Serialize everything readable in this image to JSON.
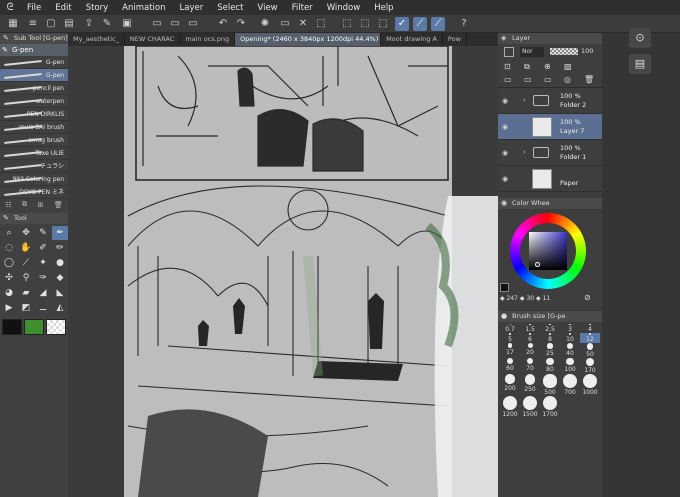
{
  "app": {
    "logo": "ᘓ"
  },
  "menu": [
    "File",
    "Edit",
    "Story",
    "Animation",
    "Layer",
    "Select",
    "View",
    "Filter",
    "Window",
    "Help"
  ],
  "tabs": [
    {
      "label": "My_aesthetic_",
      "active": false
    },
    {
      "label": "NEW CHARAC",
      "active": false
    },
    {
      "label": "main ocs.png",
      "active": false
    },
    {
      "label": "Opening* (2460 x 3840px 1200dpi 44.4%)",
      "active": true
    },
    {
      "label": "Moot drawing A",
      "active": false
    },
    {
      "label": "Pow",
      "active": false
    }
  ],
  "subtool": {
    "header": "Sub Tool [G-pen]",
    "current": "G-pen",
    "brushes": [
      {
        "label": "G-pen",
        "selected": false
      },
      {
        "label": "G-pen",
        "selected": true
      },
      {
        "label": "pencil pen",
        "selected": false
      },
      {
        "label": "waterpen",
        "selected": false
      },
      {
        "label": "PEN DIRKLIS",
        "selected": false
      },
      {
        "label": "muis SAI brush",
        "selected": false
      },
      {
        "label": "smog brush",
        "selected": false
      },
      {
        "label": "Taxe ULIE",
        "selected": false
      },
      {
        "label": "チュラシ",
        "selected": false
      },
      {
        "label": "993 Coloring pen",
        "selected": false
      },
      {
        "label": "DOYO PEN ミネ",
        "selected": false
      }
    ]
  },
  "tool_panel": {
    "header": "Tool",
    "icons": [
      "search-icon",
      "move-icon",
      "pen-icon",
      "pen-alt-icon",
      "lasso-icon",
      "hand-icon",
      "brush-icon",
      "pencil-icon",
      "oval-select-icon",
      "eyedropper-icon",
      "sparkle-icon",
      "drop-icon",
      "move-layer-icon",
      "pin-icon",
      "pen-nib-icon",
      "eraser-icon",
      "fill-icon",
      "gradient-icon",
      "ruler-icon",
      "shape-icon",
      "text-icon",
      "balloon-icon",
      "line-icon",
      "vector-icon"
    ]
  },
  "colors": {
    "main": "#111111",
    "sub": "#3f8f2f",
    "accent": "#5c7aa8",
    "canvas_bg": "#bdbdbd"
  },
  "layer_panel": {
    "header": "Layer",
    "blend": "Nor",
    "opacity": "100",
    "layers": [
      {
        "opacity": "100 %",
        "name": "Folder 2",
        "type": "folder",
        "selected": false
      },
      {
        "opacity": "100 %",
        "name": "Layer 7",
        "type": "raster",
        "selected": true
      },
      {
        "opacity": "100 %",
        "name": "Folder 1",
        "type": "folder",
        "selected": false
      },
      {
        "opacity": "",
        "name": "Paper",
        "type": "paper",
        "selected": false
      }
    ]
  },
  "color_wheel": {
    "header": "Color Whee",
    "h": "247",
    "s": "30",
    "v": "11"
  },
  "brush_size": {
    "header": "Brush size [G-pe",
    "sizes": [
      "0.7",
      "1.5",
      "2.5",
      "3",
      "4",
      "5",
      "6",
      "8",
      "10",
      "12",
      "17",
      "20",
      "25",
      "40",
      "50",
      "60",
      "70",
      "80",
      "100",
      "170",
      "200",
      "250",
      "500",
      "700",
      "1000",
      "1200",
      "1500",
      "1700"
    ],
    "selected": "12"
  }
}
